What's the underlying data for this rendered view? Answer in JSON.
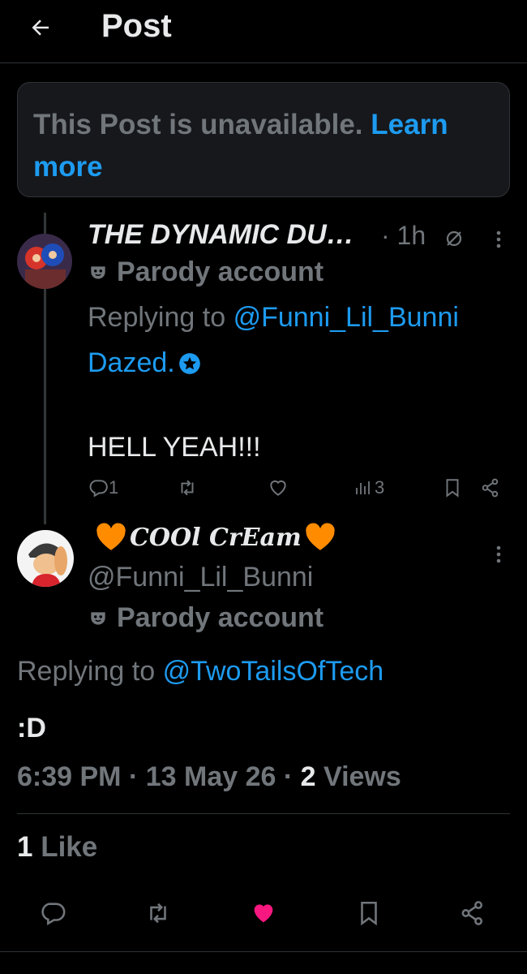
{
  "header": {
    "title": "Post"
  },
  "notice": {
    "text": "This Post is unavailable.",
    "link": "Learn more"
  },
  "reply_post": {
    "display_name": "THE DYNAMIC DU…",
    "time": "· 1h",
    "label": "Parody account",
    "replying_prefix": "Replying to",
    "replying_handle": "@Funni_Lil_Bunni",
    "body_line1": "Dazed.",
    "body_line2": "HELL YEAH!!!",
    "reply_count": "1",
    "view_count": "3"
  },
  "main_post": {
    "display_name": "𝒞𝑜𝑜𝓁 𝒞𝓇𝑒𝒶𝓂",
    "display_name_text": "COOl CrEam",
    "handle": "@Funni_Lil_Bunni",
    "label": "Parody account",
    "replying_prefix": "Replying to",
    "replying_handle": "@TwoTailsOfTech",
    "body": ":D",
    "time": "6:39 PM",
    "date": "13 May 26",
    "views": "2",
    "views_label": "Views",
    "likes": "1",
    "likes_label": "Like"
  },
  "icons": {
    "back": "arrow-left-icon",
    "more": "more-vertical-icon",
    "reply": "comment-icon",
    "repost": "repost-icon",
    "like": "heart-icon",
    "views": "bar-chart-icon",
    "bookmark": "bookmark-icon",
    "share": "share-icon",
    "parody": "mask-icon",
    "verified": "star-badge-icon",
    "hidden": "circle-slash-icon"
  },
  "colors": {
    "accent": "#1d9bf0",
    "like": "#f91880",
    "muted": "#71767b",
    "text": "#e7e9ea",
    "orange_heart": "#ff8c00"
  }
}
